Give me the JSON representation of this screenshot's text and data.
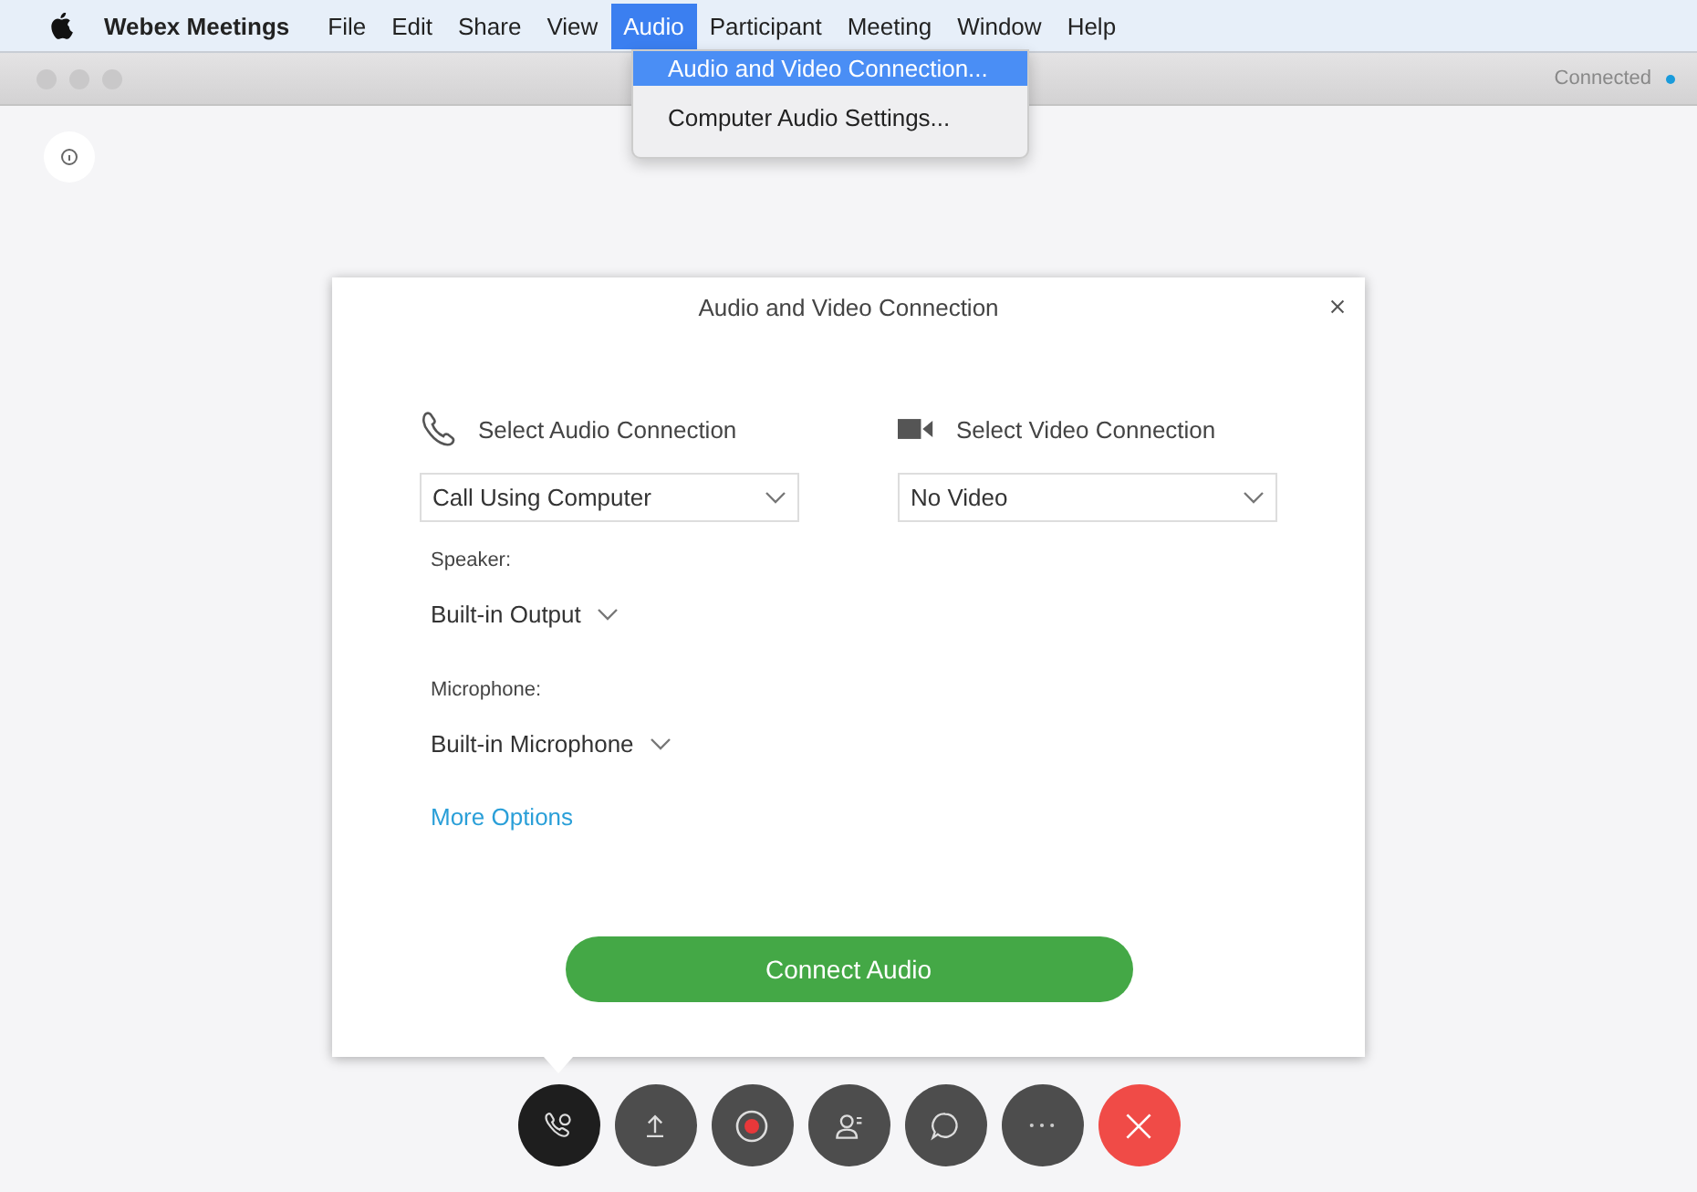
{
  "menu_bar": {
    "app_name": "Webex Meetings",
    "items": [
      {
        "label": "File",
        "selected": false
      },
      {
        "label": "Edit",
        "selected": false
      },
      {
        "label": "Share",
        "selected": false
      },
      {
        "label": "View",
        "selected": false
      },
      {
        "label": "Audio",
        "selected": true
      },
      {
        "label": "Participant",
        "selected": false
      },
      {
        "label": "Meeting",
        "selected": false
      },
      {
        "label": "Window",
        "selected": false
      },
      {
        "label": "Help",
        "selected": false
      }
    ]
  },
  "audio_menu": {
    "items": [
      {
        "label": "Audio and Video Connection...",
        "selected": true
      },
      {
        "label": "Computer Audio Settings...",
        "selected": false
      }
    ]
  },
  "window": {
    "status": "Connected"
  },
  "dialog": {
    "title": "Audio and Video Connection",
    "audio": {
      "heading": "Select Audio Connection",
      "value": "Call Using Computer",
      "speaker_label": "Speaker:",
      "speaker": "Built-in Output",
      "microphone_label": "Microphone:",
      "microphone": "Built-in Microphone",
      "link": "More Options"
    },
    "video": {
      "heading": "Select Video Connection",
      "value": "No Video"
    },
    "button": "Connect Audio"
  },
  "toolbar": [
    {
      "kind": "audio",
      "active": true
    },
    {
      "kind": "share",
      "active": false
    },
    {
      "kind": "record",
      "active": false
    },
    {
      "kind": "participants",
      "active": false
    },
    {
      "kind": "chat",
      "active": false
    },
    {
      "kind": "more",
      "active": false
    },
    {
      "kind": "leave",
      "active": false
    }
  ]
}
